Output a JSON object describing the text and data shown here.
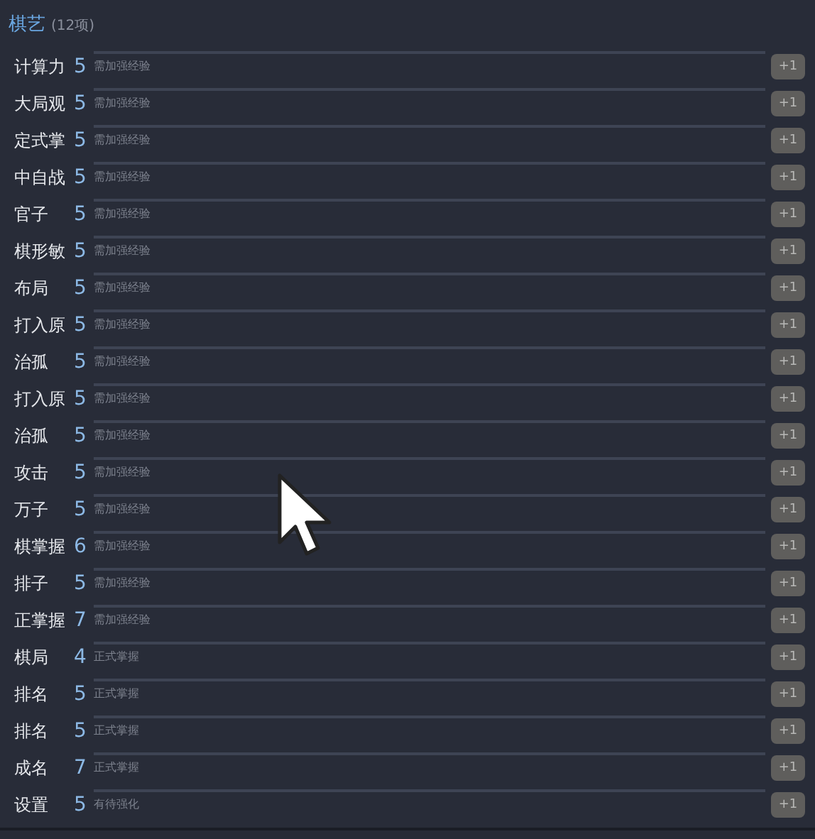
{
  "section": {
    "title": "棋艺",
    "count": "(12项)"
  },
  "rows": [
    {
      "name": "计算力",
      "value": "5",
      "note": "需加强经验",
      "button": "+1"
    },
    {
      "name": "大局观",
      "value": "5",
      "note": "需加强经验",
      "button": "+1"
    },
    {
      "name": "定式掌",
      "value": "5",
      "note": "需加强经验",
      "button": "+1"
    },
    {
      "name": "中自战",
      "value": "5",
      "note": "需加强经验",
      "button": "+1"
    },
    {
      "name": "官子",
      "value": "5",
      "note": "需加强经验",
      "button": "+1"
    },
    {
      "name": "棋形敏",
      "value": "5",
      "note": "需加强经验",
      "button": "+1"
    },
    {
      "name": "布局",
      "value": "5",
      "note": "需加强经验",
      "button": "+1"
    },
    {
      "name": "打入原",
      "value": "5",
      "note": "需加强经验",
      "button": "+1"
    },
    {
      "name": "治孤",
      "value": "5",
      "note": "需加强经验",
      "button": "+1"
    },
    {
      "name": "打入原",
      "value": "5",
      "note": "需加强经验",
      "button": "+1"
    },
    {
      "name": "治孤",
      "value": "5",
      "note": "需加强经验",
      "button": "+1"
    },
    {
      "name": "攻击",
      "value": "5",
      "note": "需加强经验",
      "button": "+1"
    },
    {
      "name": "万子",
      "value": "5",
      "note": "需加强经验",
      "button": "+1"
    },
    {
      "name": "棋掌握",
      "value": "6",
      "note": "需加强经验",
      "button": "+1"
    },
    {
      "name": "排子",
      "value": "5",
      "note": "需加强经验",
      "button": "+1"
    },
    {
      "name": "正掌握",
      "value": "7",
      "note": "需加强经验",
      "button": "+1"
    },
    {
      "name": "棋局",
      "value": "4",
      "note": "正式掌握",
      "button": "+1"
    },
    {
      "name": "排名",
      "value": "5",
      "note": "正式掌握",
      "button": "+1"
    },
    {
      "name": "排名",
      "value": "5",
      "note": "正式掌握",
      "button": "+1"
    },
    {
      "name": "成名",
      "value": "7",
      "note": "正式掌握",
      "button": "+1"
    },
    {
      "name": "设置",
      "value": "5",
      "note": "有待强化",
      "button": "+1"
    }
  ]
}
